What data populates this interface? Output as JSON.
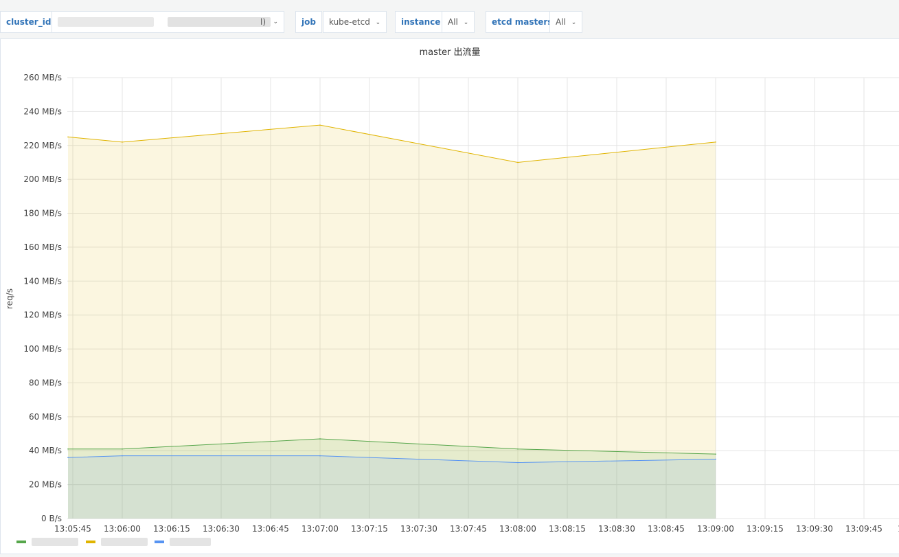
{
  "variables": [
    {
      "label": "cluster_id",
      "value": "",
      "tail": "l)"
    },
    {
      "label": "job",
      "value": "kube-etcd"
    },
    {
      "label": "instance",
      "value": "All"
    },
    {
      "label": "etcd masters",
      "value": "All"
    }
  ],
  "panel": {
    "title": "master 出流量"
  },
  "chart_data": {
    "type": "area",
    "title": "master 出流量",
    "ylabel": "req/s",
    "xlabel": "",
    "ylim": [
      0,
      260
    ],
    "y_unit": "MB/s",
    "grid": true,
    "legend_placement": "bottom-left",
    "y_ticks": [
      "0 B/s",
      "20 MB/s",
      "40 MB/s",
      "60 MB/s",
      "80 MB/s",
      "100 MB/s",
      "120 MB/s",
      "140 MB/s",
      "160 MB/s",
      "180 MB/s",
      "200 MB/s",
      "220 MB/s",
      "240 MB/s",
      "260 MB/s"
    ],
    "x_ticks": [
      "13:05:45",
      "13:06:00",
      "13:06:15",
      "13:06:30",
      "13:06:45",
      "13:07:00",
      "13:07:15",
      "13:07:30",
      "13:07:45",
      "13:08:00",
      "13:08:15",
      "13:08:30",
      "13:08:45",
      "13:09:00",
      "13:09:15",
      "13:09:30",
      "13:09:45"
    ],
    "x": [
      "13:05:45",
      "13:06:00",
      "13:07:00",
      "13:08:00",
      "13:09:00"
    ],
    "series": [
      {
        "color": "#56a64b",
        "values": [
          41,
          41,
          47,
          41,
          38
        ]
      },
      {
        "color": "#e0b400",
        "values": [
          225,
          222,
          232,
          210,
          222
        ]
      },
      {
        "color": "#5794f2",
        "values": [
          36,
          37,
          37,
          33,
          35
        ]
      }
    ]
  }
}
